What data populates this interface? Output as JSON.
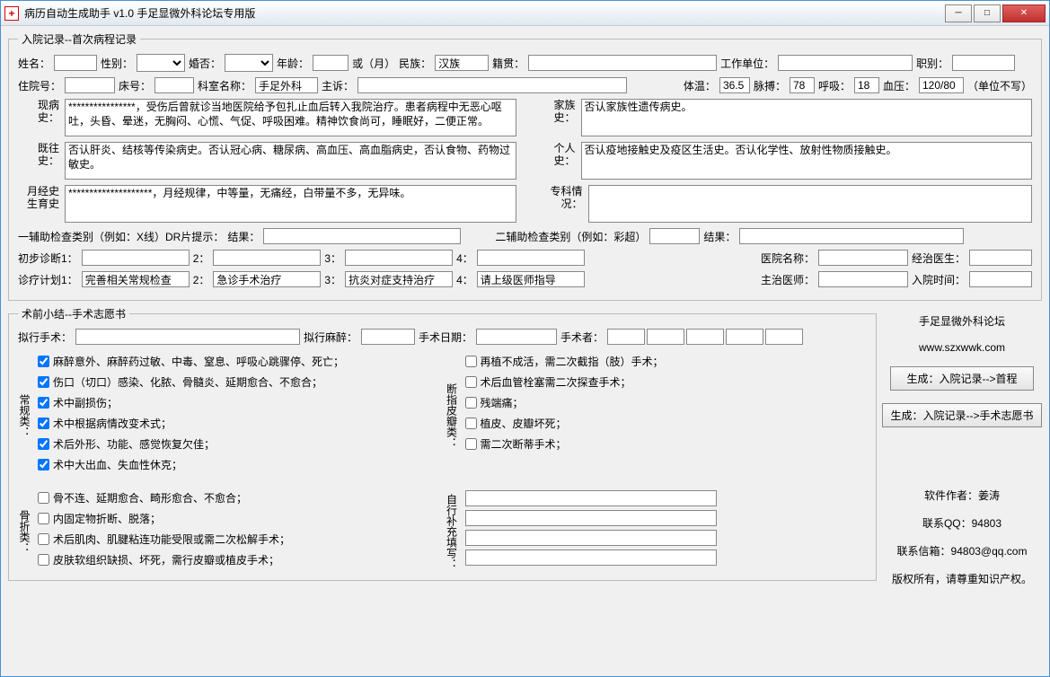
{
  "window": {
    "title": "病历自动生成助手 v1.0 手足显微外科论坛专用版"
  },
  "fieldset1": {
    "legend": "入院记录--首次病程记录"
  },
  "row1": {
    "name_lbl": "姓名：",
    "sex_lbl": "性别：",
    "marry_lbl": "婚否：",
    "age_lbl": "年龄：",
    "or_month_lbl": "或（月）",
    "nation_lbl": "民族：",
    "nation_val": "汉族",
    "native_lbl": "籍贯：",
    "work_lbl": "工作单位：",
    "job_lbl": "职别："
  },
  "row2": {
    "hosp_no_lbl": "住院号：",
    "bed_lbl": "床号：",
    "dept_lbl": "科室名称：",
    "dept_val": "手足外科",
    "chief_lbl": "主诉：",
    "temp_lbl": "体温：",
    "temp_val": "36.5",
    "pulse_lbl": "脉搏：",
    "pulse_val": "78",
    "breath_lbl": "呼吸：",
    "breath_val": "18",
    "bp_lbl": "血压：",
    "bp_val": "120/80",
    "unit_lbl": "（单位不写）"
  },
  "history": {
    "present_lbl": "现病史：",
    "present_val": "****************，受伤后曾就诊当地医院给予包扎止血后转入我院治疗。患者病程中无恶心呕吐，头昏、晕迷，无胸闷、心慌、气促、呼吸困难。精神饮食尚可，睡眠好，二便正常。",
    "family_lbl": "家族史：",
    "family_val": "否认家族性遗传病史。",
    "past_lbl": "既往史：",
    "past_val": "否认肝炎、结核等传染病史。否认冠心病、糖尿病、高血压、高血脂病史，否认食物、药物过敏史。",
    "personal_lbl": "个人史：",
    "personal_val": "否认疫地接触史及疫区生活史。否认化学性、放射性物质接触史。",
    "menstrual_lbl": "月经史生育史",
    "menstrual_val": "********************，月经规律，中等量，无痛经，白带量不多，无异味。",
    "special_lbl": "专科情况："
  },
  "aux": {
    "aux1_lbl": "一辅助检查类别（例如：X线）DR片提示：",
    "result_lbl": "结果：",
    "aux2_lbl": "二辅助检查类别（例如：彩超）"
  },
  "diag": {
    "d1_lbl": "初步诊断1：",
    "d2_lbl": "2：",
    "d3_lbl": "3：",
    "d4_lbl": "4：",
    "hosp_name_lbl": "医院名称：",
    "doctor_lbl": "经治医生：",
    "plan1_lbl": "诊疗计划1：",
    "plan1_val": "完善相关常规检查",
    "plan2_val": "急诊手术治疗",
    "plan3_val": "抗炎对症支持治疗",
    "plan4_val": "请上级医师指导",
    "attending_lbl": "主治医师：",
    "admit_time_lbl": "入院时间："
  },
  "fieldset2": {
    "legend": "术前小结--手术志愿书"
  },
  "surgery": {
    "proposed_lbl": "拟行手术：",
    "anesthesia_lbl": "拟行麻醉：",
    "date_lbl": "手术日期：",
    "surgeon_lbl": "手术者："
  },
  "checks": {
    "routine_lbl": "常规类：",
    "r1": "麻醉意外、麻醉药过敏、中毒、窒息、呼吸心跳骤停、死亡；",
    "r2": "伤口（切口）感染、化脓、骨髓炎、延期愈合、不愈合；",
    "r3": "术中副损伤；",
    "r4": "术中根据病情改变术式；",
    "r5": "术后外形、功能、感觉恢复欠佳；",
    "r6": "术中大出血、失血性休克；",
    "replant_lbl": "断指皮瓣类：",
    "p1": "再植不成活，需二次截指（肢）手术；",
    "p2": "术后血管栓塞需二次探查手术；",
    "p3": "残端痛；",
    "p4": "植皮、皮瓣坏死；",
    "p5": "需二次断蒂手术；",
    "bone_lbl": "骨折类：",
    "b1": "骨不连、延期愈合、畸形愈合、不愈合；",
    "b2": "内固定物折断、脱落；",
    "b3": "术后肌肉、肌腱粘连功能受限或需二次松解手术；",
    "b4": "皮肤软组织缺损、坏死，需行皮瓣或植皮手术；",
    "custom_lbl": "自行补充填写："
  },
  "side": {
    "forum": "手足显微外科论坛",
    "url": "www.szxwwk.com",
    "btn1": "生成：入院记录-->首程",
    "btn2": "生成：入院记录-->手术志愿书",
    "author": "软件作者：姜涛",
    "qq": "联系QQ：94803",
    "email": "联系信箱：94803@qq.com",
    "copyright": "版权所有，请尊重知识产权。"
  }
}
